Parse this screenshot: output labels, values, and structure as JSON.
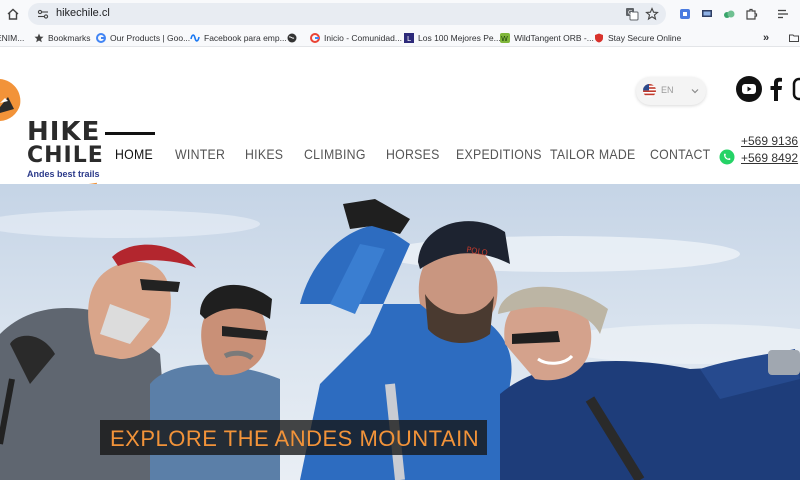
{
  "browser": {
    "url": "hikechile.cl",
    "bookmarks": [
      {
        "label": "ENIM...",
        "icon": "folder-icon"
      },
      {
        "label": "Bookmarks",
        "icon": "star-icon"
      },
      {
        "label": "Our Products | Goo...",
        "icon": "google-icon"
      },
      {
        "label": "Facebook para emp...",
        "icon": "meta-icon"
      },
      {
        "label": "",
        "icon": "globe-icon"
      },
      {
        "label": "Inicio - Comunidad...",
        "icon": "google-icon"
      },
      {
        "label": "Los 100 Mejores Pe...",
        "icon": "l-icon"
      },
      {
        "label": "WildTangent ORB -...",
        "icon": "wildtangent-icon"
      },
      {
        "label": "Stay Secure Online",
        "icon": "shield-icon"
      }
    ]
  },
  "site": {
    "logo": {
      "line1": "HIKE",
      "line2": "CHILE",
      "tagline": "Andes best trails"
    },
    "language": {
      "code": "EN"
    },
    "nav": [
      {
        "label": "HOME",
        "active": true
      },
      {
        "label": "WINTER"
      },
      {
        "label": "HIKES"
      },
      {
        "label": "CLIMBING"
      },
      {
        "label": "HORSES"
      },
      {
        "label": "EXPEDITIONS"
      },
      {
        "label": "TAILOR MADE"
      },
      {
        "label": "CONTACT"
      }
    ],
    "phones": [
      "+569 9136",
      "+569 8492"
    ],
    "hero": {
      "title": "EXPLORE THE ANDES MOUNTAIN"
    },
    "colors": {
      "accent": "#f29339",
      "brand_blue": "#2b3a8a",
      "whatsapp": "#25d366"
    }
  }
}
